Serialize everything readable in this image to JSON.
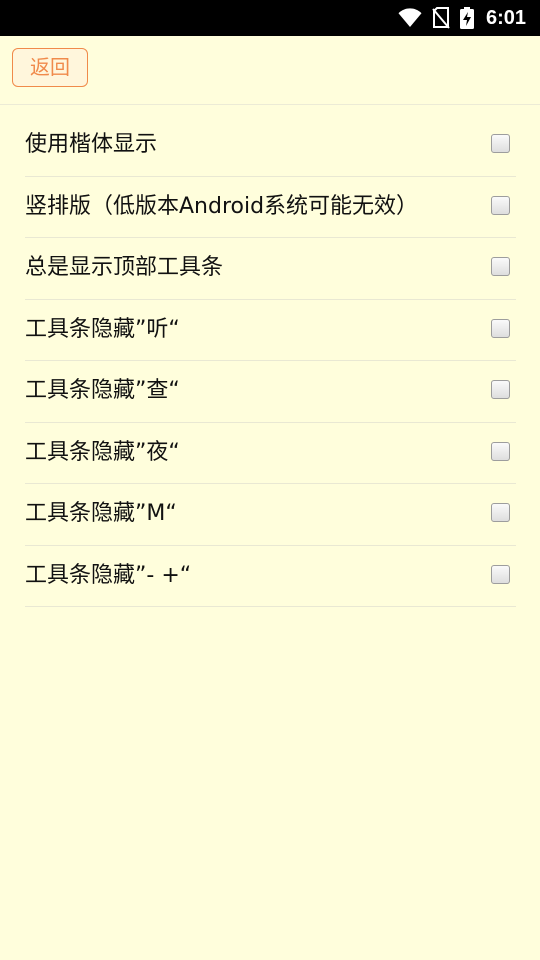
{
  "status_bar": {
    "time": "6:01",
    "icons": [
      "wifi-icon",
      "no-sim-icon",
      "battery-charging-icon"
    ]
  },
  "top_bar": {
    "back_label": "返回"
  },
  "settings": [
    {
      "label": "使用楷体显示",
      "checked": false
    },
    {
      "label": "竖排版（低版本Android系统可能无效）",
      "checked": false
    },
    {
      "label": "总是显示顶部工具条",
      "checked": false
    },
    {
      "label": "工具条隐藏”听“",
      "checked": false
    },
    {
      "label": "工具条隐藏”查“",
      "checked": false
    },
    {
      "label": "工具条隐藏”夜“",
      "checked": false
    },
    {
      "label": "工具条隐藏”M“",
      "checked": false
    },
    {
      "label": "工具条隐藏”- +“",
      "checked": false
    }
  ],
  "colors": {
    "background": "#fffedc",
    "accent": "#f08a4b",
    "status_bar": "#000000"
  }
}
